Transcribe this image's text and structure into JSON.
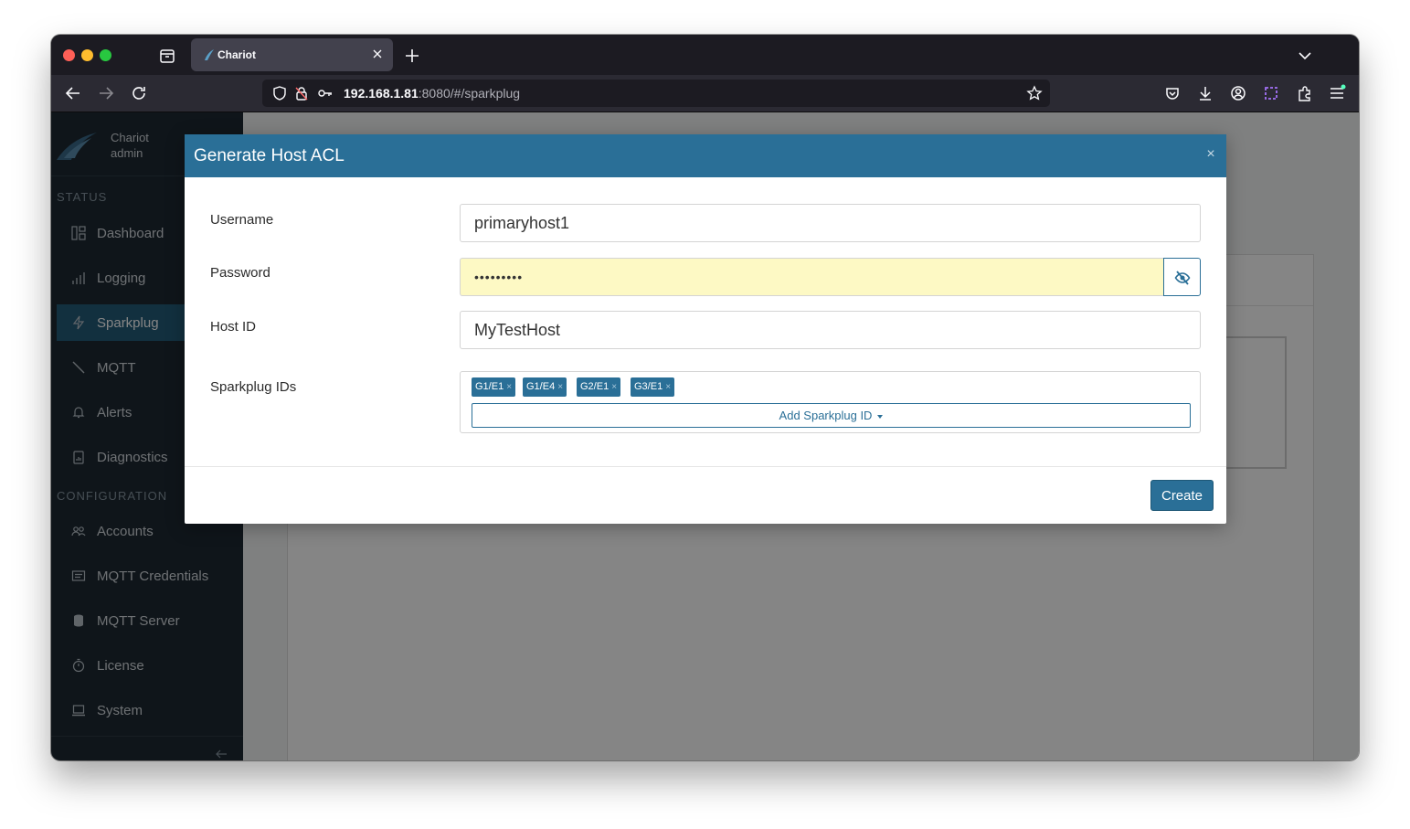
{
  "browser": {
    "tab_title": "Chariot",
    "url_host": "192.168.1.81",
    "url_rest": ":8080/#/sparkplug"
  },
  "sidebar": {
    "brand_name": "Chariot",
    "user": "admin",
    "status_heading": "STATUS",
    "status_items": [
      {
        "label": "Dashboard",
        "icon": "dashboard-icon"
      },
      {
        "label": "Logging",
        "icon": "bar-chart-icon"
      },
      {
        "label": "Sparkplug",
        "icon": "lightning-icon"
      },
      {
        "label": "MQTT",
        "icon": "antenna-icon"
      },
      {
        "label": "Alerts",
        "icon": "bell-icon"
      },
      {
        "label": "Diagnostics",
        "icon": "clipboard-icon"
      }
    ],
    "config_heading": "CONFIGURATION",
    "config_items": [
      {
        "label": "Accounts",
        "icon": "users-icon"
      },
      {
        "label": "MQTT Credentials",
        "icon": "list-icon"
      },
      {
        "label": "MQTT Server",
        "icon": "database-icon"
      },
      {
        "label": "License",
        "icon": "stopwatch-icon"
      },
      {
        "label": "System",
        "icon": "laptop-icon"
      }
    ],
    "active_item": "Sparkplug"
  },
  "modal": {
    "title": "Generate Host ACL",
    "username_label": "Username",
    "username_value": "primaryhost1",
    "password_label": "Password",
    "password_value": "•••••••••",
    "host_id_label": "Host ID",
    "host_id_value": "MyTestHost",
    "sparkplug_ids_label": "Sparkplug IDs",
    "sparkplug_ids": [
      "G1/E1",
      "G1/E4",
      "G2/E1",
      "G3/E1"
    ],
    "chip_remove": "×",
    "add_id_label": "Add Sparkplug ID",
    "create_label": "Create",
    "close_glyph": "×"
  },
  "colors": {
    "accent": "#2a6f97",
    "sidebar_bg": "#1e2a33",
    "password_autofill_bg": "#fdf9c4"
  }
}
